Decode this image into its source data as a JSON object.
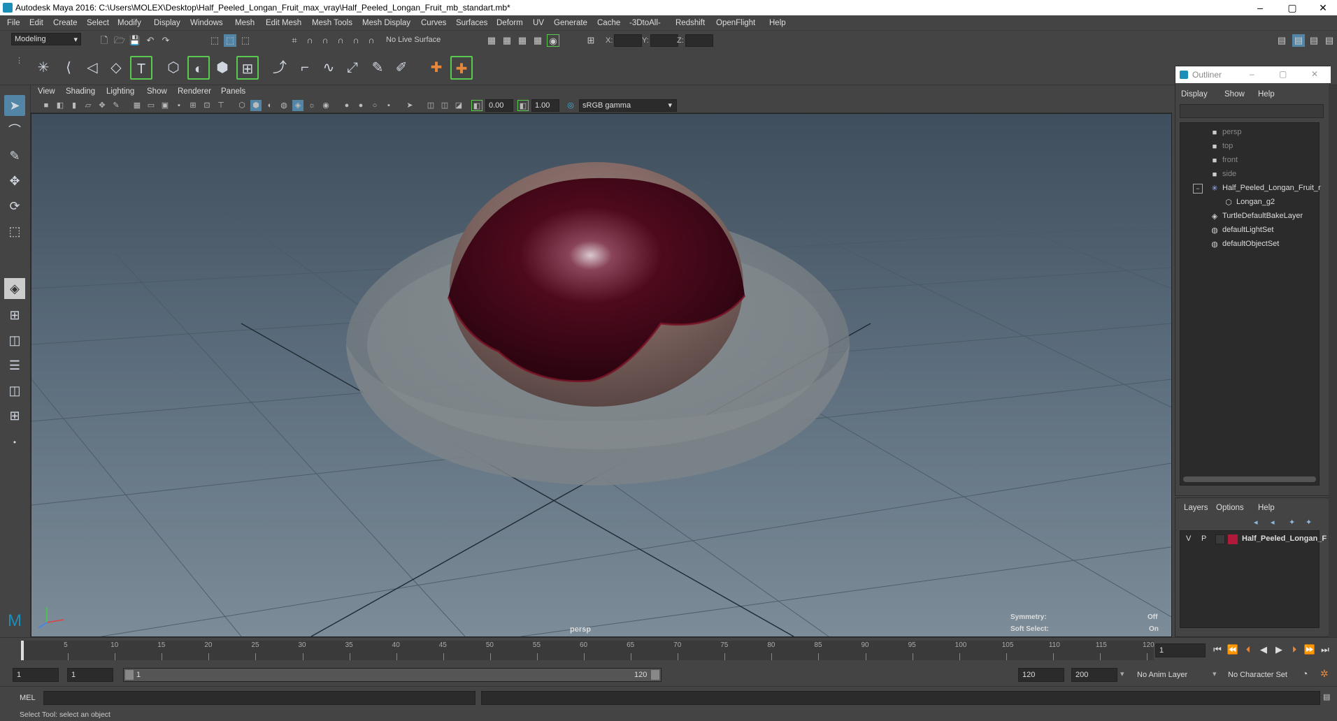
{
  "window": {
    "title": "Autodesk Maya 2016: C:\\Users\\MOLEX\\Desktop\\Half_Peeled_Longan_Fruit_max_vray\\Half_Peeled_Longan_Fruit_mb_standart.mb*",
    "minimize": "–",
    "maximize": "▢",
    "close": "✕"
  },
  "menubar": [
    "File",
    "Edit",
    "Create",
    "Select",
    "Modify",
    "Display",
    "Windows",
    "Mesh",
    "Edit Mesh",
    "Mesh Tools",
    "Mesh Display",
    "Curves",
    "Surfaces",
    "Deform",
    "UV",
    "Generate",
    "Cache",
    "-3DtoAll-",
    "Redshift",
    "OpenFlight",
    "Help"
  ],
  "status_line": {
    "mode": "Modeling",
    "live_surface": "No Live Surface",
    "x_label": "X:",
    "y_label": "Y:",
    "z_label": "Z:"
  },
  "viewport_menu": [
    "View",
    "Shading",
    "Lighting",
    "Show",
    "Renderer",
    "Panels"
  ],
  "viewport_toolbar": {
    "exposure": "0.00",
    "gamma": "1.00",
    "colorspace": "sRGB gamma"
  },
  "viewport": {
    "camera": "persp",
    "symmetry_label": "Symmetry:",
    "symmetry_value": "Off",
    "soft_select_label": "Soft Select:",
    "soft_select_value": "On"
  },
  "outliner": {
    "title": "Outliner",
    "menu": [
      "Display",
      "Show",
      "Help"
    ],
    "items": [
      {
        "label": "persp",
        "icon": "camera-icon",
        "dim": true
      },
      {
        "label": "top",
        "icon": "camera-icon",
        "dim": true
      },
      {
        "label": "front",
        "icon": "camera-icon",
        "dim": true
      },
      {
        "label": "side",
        "icon": "camera-icon",
        "dim": true
      },
      {
        "label": "Half_Peeled_Longan_Fruit_r",
        "icon": "group-icon",
        "dim": false
      },
      {
        "label": "Longan_g2",
        "icon": "mesh-icon",
        "dim": false
      },
      {
        "label": "TurtleDefaultBakeLayer",
        "icon": "layer-icon",
        "dim": false
      },
      {
        "label": "defaultLightSet",
        "icon": "set-icon",
        "dim": false
      },
      {
        "label": "defaultObjectSet",
        "icon": "set-icon",
        "dim": false
      }
    ]
  },
  "layers": {
    "menu": [
      "Layers",
      "Options",
      "Help"
    ],
    "row": {
      "v": "V",
      "p": "P",
      "name": "Half_Peeled_Longan_F",
      "color": "#b0193a"
    }
  },
  "timeline": {
    "ticks": [
      "5",
      "10",
      "15",
      "20",
      "25",
      "30",
      "35",
      "40",
      "45",
      "50",
      "55",
      "60",
      "65",
      "70",
      "75",
      "80",
      "85",
      "90",
      "95",
      "100",
      "105",
      "110",
      "115",
      "120"
    ],
    "current_frame": "1",
    "current_field": "1"
  },
  "range": {
    "start": "1",
    "start2": "1",
    "slider_start": "1",
    "slider_end": "120",
    "end": "120",
    "end2": "200",
    "anim_layer": "No Anim Layer",
    "character_set": "No Character Set"
  },
  "command": {
    "label": "MEL"
  },
  "help_line": "Select Tool: select an object",
  "colors": {
    "accent": "#5285a6",
    "fruit": "#5a0a1e"
  }
}
